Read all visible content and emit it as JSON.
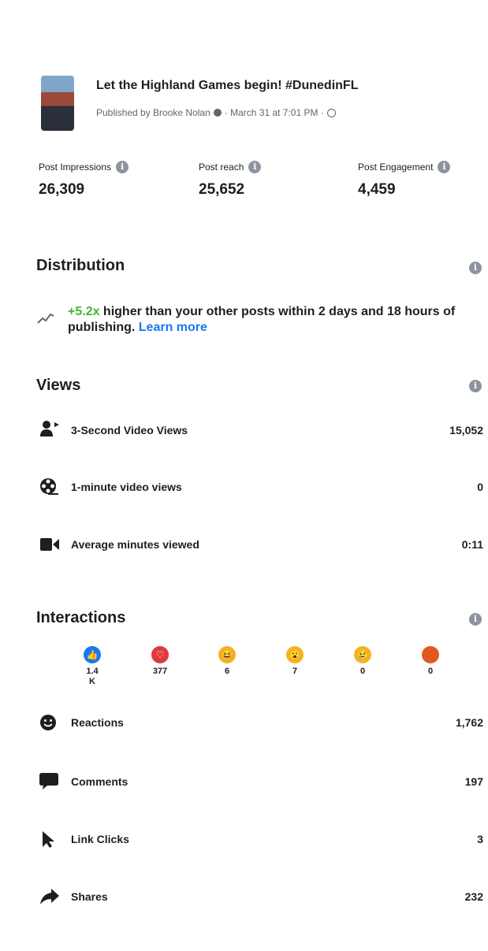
{
  "post": {
    "title": "Let the Highland Games begin! #DunedinFL",
    "published_by": "Published by Brooke Nolan",
    "date": "· March 31 at 7:01 PM ·"
  },
  "metrics": [
    {
      "label": "Post Impressions",
      "value": "26,309"
    },
    {
      "label": "Post reach",
      "value": "25,652"
    },
    {
      "label": "Post Engagement",
      "value": "4,459"
    }
  ],
  "distribution": {
    "title": "Distribution",
    "multiplier": "+5.2x",
    "text": " higher than your other posts within 2 days and 18 hours of publishing. ",
    "link": "Learn more"
  },
  "views": {
    "title": "Views",
    "rows": [
      {
        "icon": "person-video-icon",
        "label": "3-Second Video Views",
        "value": "15,052"
      },
      {
        "icon": "film-reel-icon",
        "label": "1-minute video views",
        "value": "0"
      },
      {
        "icon": "video-camera-icon",
        "label": "Average minutes viewed",
        "value": "0:11"
      }
    ]
  },
  "interactions": {
    "title": "Interactions",
    "reactions": [
      {
        "name": "like",
        "count": "1.4\nK",
        "color": "#1877f2"
      },
      {
        "name": "love",
        "count": "377",
        "color": "#e0393e"
      },
      {
        "name": "haha",
        "count": "6",
        "color": "#f7b125"
      },
      {
        "name": "wow",
        "count": "7",
        "color": "#f7b125"
      },
      {
        "name": "sad",
        "count": "0",
        "color": "#f7b125"
      },
      {
        "name": "angry",
        "count": "0",
        "color": "#e05a1e"
      }
    ],
    "rows": [
      {
        "icon": "smiley-icon",
        "label": "Reactions",
        "value": "1,762"
      },
      {
        "icon": "comment-icon",
        "label": "Comments",
        "value": "197"
      },
      {
        "icon": "cursor-icon",
        "label": "Link Clicks",
        "value": "3"
      },
      {
        "icon": "share-icon",
        "label": "Shares",
        "value": "232"
      }
    ]
  },
  "info_glyph": "i"
}
